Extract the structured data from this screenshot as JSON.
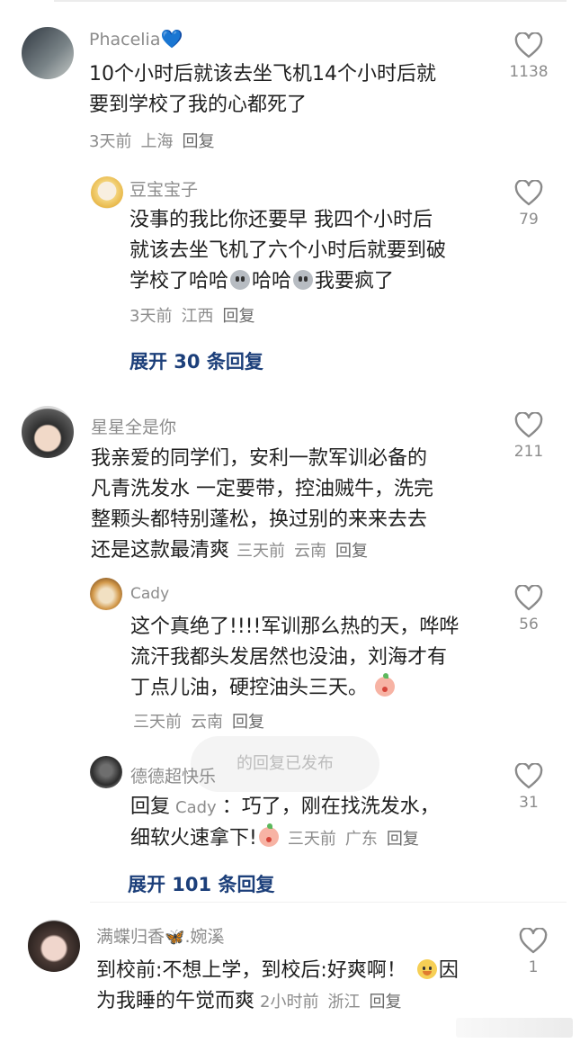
{
  "comments": [
    {
      "user": "Phacelia",
      "user_suffix": "💙",
      "lines": [
        "10个小时后就该去坐飞机14个小时后就",
        "要到学校了我的心都死了"
      ],
      "time": "3天前",
      "location": "上海",
      "reply": "回复",
      "likes": "1138",
      "avatar_colors": [
        "#3f4a55",
        "#9aa3a6"
      ]
    },
    {
      "user": "豆宝宝子",
      "lines": [
        "没事的我比你还要早 我四个小时后",
        "就该去坐飞机了六个小时后就要到破"
      ],
      "line3_a": "学校了哈哈",
      "line3_b": "哈哈",
      "line3_c": "我要疯了",
      "time": "3天前",
      "location": "江西",
      "reply": "回复",
      "likes": "79",
      "avatar_colors": [
        "#f3d37a",
        "#f8efe0"
      ]
    },
    {
      "user": "星星全是你",
      "lines": [
        "我亲爱的同学们，安利一款军训必备的",
        "凡青洗发水 一定要带，控油贼牛，洗完",
        "整颗头都特别蓬松，换过别的来来去去"
      ],
      "line4": "还是这款最清爽",
      "time": "三天前",
      "location": "云南",
      "reply": "回复",
      "likes": "211",
      "avatar_colors": [
        "#3b3b3b",
        "#f1d9c8"
      ]
    },
    {
      "user": "Cady",
      "lines": [
        "这个真绝了!!!!军训那么热的天，哗哗",
        "流汗我都头发居然也没油，刘海才有"
      ],
      "line3": "丁点儿油，硬控油头三天。",
      "time": "三天前",
      "location": "云南",
      "reply": "回复",
      "likes": "56",
      "avatar_colors": [
        "#c98a3c",
        "#f1e0c2"
      ]
    },
    {
      "user": "德德超快乐",
      "reply_prefix": "回复",
      "reply_to": "Cady",
      "reply_colon": "：",
      "line1_text": "巧了，刚在找洗发水，",
      "line2": "细软火速拿下!",
      "time": "三天前",
      "location": "广东",
      "reply": "回复",
      "likes": "31",
      "avatar_colors": [
        "#2c2c2c",
        "#6e6e6e"
      ]
    },
    {
      "user": "满蝶归香",
      "user_suffix": ".婉溪",
      "line1_a": "到校前:不想上学，到校后:好爽啊！",
      "line1_b": "因",
      "line2": "为我睡的午觉而爽",
      "time": "2小时前",
      "location": "浙江",
      "reply": "回复",
      "likes": "1",
      "avatar_colors": [
        "#4a3a35",
        "#f0d6cc"
      ]
    }
  ],
  "expand": [
    "展开 30 条回复",
    "展开 101 条回复"
  ],
  "toast": "的回复已发布",
  "icons": {
    "like": "heart-outline-icon"
  }
}
